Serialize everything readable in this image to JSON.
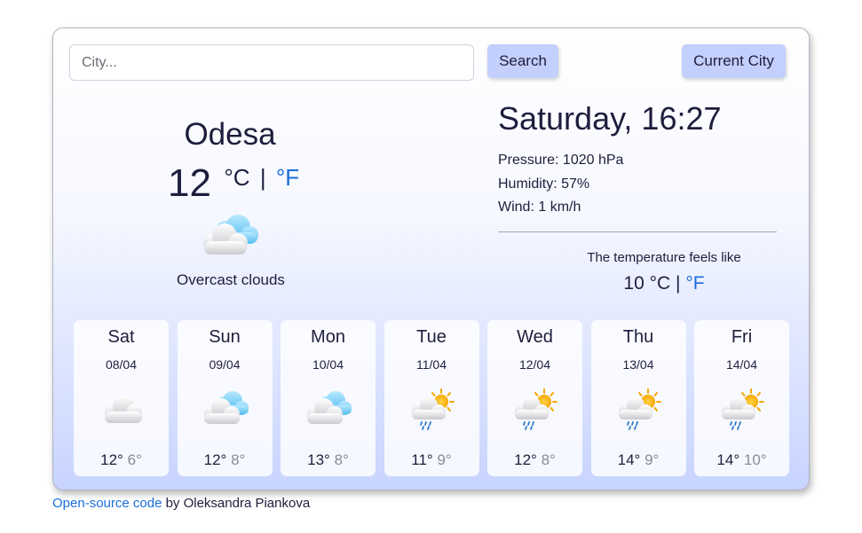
{
  "search": {
    "placeholder": "City...",
    "value": ""
  },
  "buttons": {
    "search_label": "Search",
    "current_city_label": "Current City"
  },
  "current": {
    "city": "Odesa",
    "temperature": "12",
    "unit_c": "°C",
    "unit_sep": "|",
    "unit_f": "°F",
    "icon": "overcast-clouds-icon",
    "description": "Overcast clouds",
    "datetime": "Saturday, 16:27",
    "pressure": "Pressure: 1020 hPa",
    "humidity": "Humidity: 57%",
    "wind": "Wind: 1 km/h",
    "feels_like_label": "The temperature feels like",
    "feels_like_value": "10",
    "feels_unit_c": "°C",
    "feels_unit_sep": "|",
    "feels_unit_f": "°F"
  },
  "forecast": [
    {
      "day": "Sat",
      "date": "08/04",
      "icon": "cloud-icon",
      "max": "12°",
      "min": "6°"
    },
    {
      "day": "Sun",
      "date": "09/04",
      "icon": "overcast-clouds-icon",
      "max": "12°",
      "min": "8°"
    },
    {
      "day": "Mon",
      "date": "10/04",
      "icon": "overcast-clouds-icon",
      "max": "13°",
      "min": "8°"
    },
    {
      "day": "Tue",
      "date": "11/04",
      "icon": "sun-rain-icon",
      "max": "11°",
      "min": "9°"
    },
    {
      "day": "Wed",
      "date": "12/04",
      "icon": "sun-rain-icon",
      "max": "12°",
      "min": "8°"
    },
    {
      "day": "Thu",
      "date": "13/04",
      "icon": "sun-rain-icon",
      "max": "14°",
      "min": "9°"
    },
    {
      "day": "Fri",
      "date": "14/04",
      "icon": "sun-rain-icon",
      "max": "14°",
      "min": "10°"
    }
  ],
  "footer": {
    "link_text": "Open-source code",
    "rest_text": " by Oleksandra Piankova"
  },
  "colors": {
    "accent_link": "#1a6ddb",
    "button_bg": "#c3cffc",
    "text": "#1f1d3d",
    "muted": "#8a8a95"
  }
}
